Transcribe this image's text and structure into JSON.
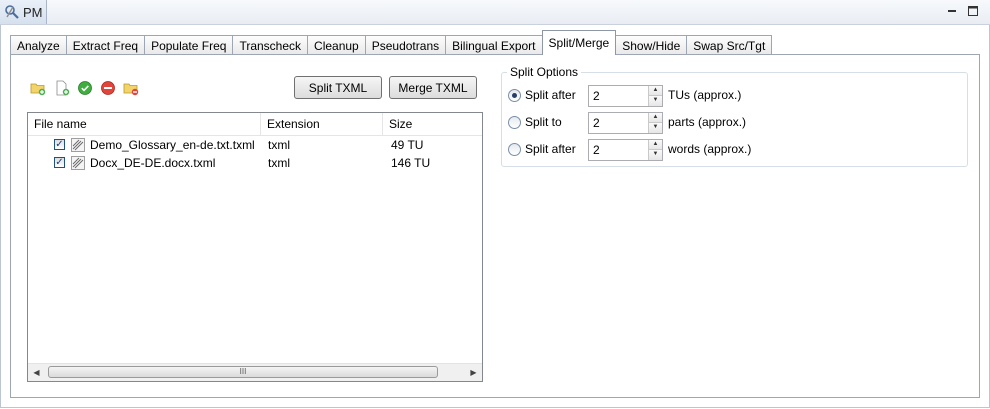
{
  "view": {
    "title": "PM"
  },
  "tabs": [
    {
      "label": "Analyze"
    },
    {
      "label": "Extract Freq"
    },
    {
      "label": "Populate Freq"
    },
    {
      "label": "Transcheck"
    },
    {
      "label": "Cleanup"
    },
    {
      "label": "Pseudotrans"
    },
    {
      "label": "Bilingual Export"
    },
    {
      "label": "Split/Merge",
      "active": true
    },
    {
      "label": "Show/Hide"
    },
    {
      "label": "Swap Src/Tgt"
    }
  ],
  "toolbar": {
    "icons": [
      "add-folder-icon",
      "add-file-icon",
      "check-icon",
      "remove-icon",
      "folder-remove-icon"
    ],
    "split_label": "Split TXML",
    "merge_label": "Merge TXML"
  },
  "table": {
    "columns": [
      "File name",
      "Extension",
      "Size"
    ],
    "rows": [
      {
        "name": "Demo_Glossary_en-de.txt.txml",
        "extension": "txml",
        "size": "49 TU",
        "checked": true
      },
      {
        "name": "Docx_DE-DE.docx.txml",
        "extension": "txml",
        "size": "146 TU",
        "checked": true
      }
    ],
    "scroll_thumb_glyph": "III"
  },
  "split_options": {
    "title": "Split Options",
    "options": [
      {
        "label": "Split after",
        "value": "2",
        "unit": "TUs (approx.)",
        "selected": true
      },
      {
        "label": "Split to",
        "value": "2",
        "unit": "parts (approx.)",
        "selected": false
      },
      {
        "label": "Split after",
        "value": "2",
        "unit": "words (approx.)",
        "selected": false
      }
    ]
  },
  "colors": {
    "accent": "#263e6b",
    "border": "#9da7b4"
  }
}
